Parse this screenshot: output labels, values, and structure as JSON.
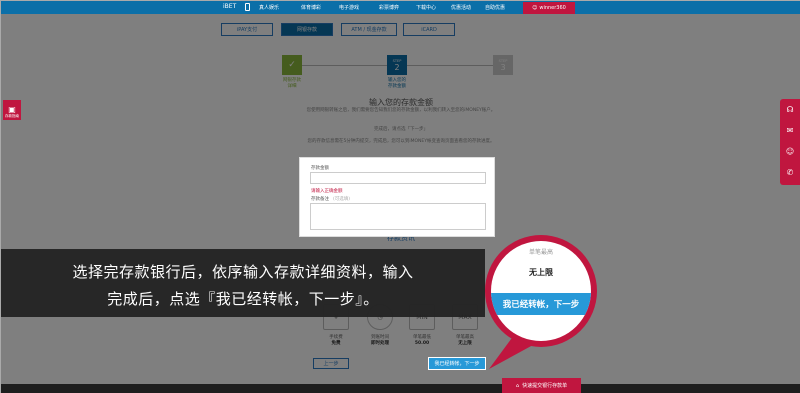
{
  "topbar": {
    "logo": "iBET",
    "nav": [
      "真人娱乐",
      "体育博彩",
      "电子游戏",
      "彩票博弈",
      "下载中心",
      "优惠活动",
      "自助优惠"
    ],
    "user_label": "winner360"
  },
  "tabs": [
    "iPAY支付",
    "网银存款",
    "ATM / 现金存款",
    "iCARD"
  ],
  "steps": [
    {
      "number": "✓",
      "label": "网银存款\n详细"
    },
    {
      "number": "2",
      "label": "输入您的\n存款金额"
    },
    {
      "number": "3",
      "label": ""
    }
  ],
  "form": {
    "title": "输入您的存款金额",
    "para1": "您使用网银转账之后，我们需要您告知我们您的存款金额，以利我们转入至您的iMONEY账户。",
    "para2": "完成后，请点选「下一步」",
    "para3": "您的存款信息需在5分钟内提交，完成后，您可以到iMONEY帐变查询页面查看您的存款进度。",
    "amount_label": "存款金额",
    "amount_error": "请输入正确金额",
    "note_label": "存款备注",
    "note_hint": "(可选填)"
  },
  "info": {
    "title": "存款资讯",
    "items": [
      {
        "label": "手续费",
        "value": "免费",
        "icon": "fee-icon"
      },
      {
        "label": "到账时间",
        "value": "即时处理",
        "icon": "clock-icon"
      },
      {
        "label": "单笔最低",
        "value": "50.00",
        "icon": "min-icon"
      },
      {
        "label": "单笔最高",
        "value": "无上限",
        "icon": "max-icon"
      }
    ]
  },
  "buttons": {
    "prev": "上一步",
    "next": "我已经转帐，下一步",
    "bank": "快速提交银行存款单"
  },
  "left_float": "存款指南",
  "banner": {
    "line1": "选择完存款银行后，依序输入存款详细资料，输入",
    "line2": "完成后，点选『我已经转帐，下一步』。"
  },
  "magnifier": {
    "faint": "单笔最高",
    "value": "无上限",
    "button": "我已经转帐，下一步"
  },
  "colors": {
    "primary": "#0b6fa8",
    "accent": "#c0163f",
    "button": "#2799d8",
    "step_done": "#8ab83c"
  }
}
